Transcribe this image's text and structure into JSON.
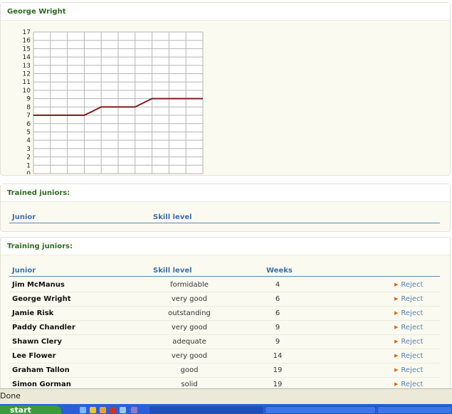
{
  "player_panel": {
    "title": "George Wright"
  },
  "chart_data": {
    "type": "line",
    "title": "",
    "xlabel": "",
    "ylabel": "",
    "x": [
      0,
      1,
      2,
      3,
      4,
      5,
      6,
      7,
      8,
      9,
      10
    ],
    "series": [
      {
        "values": [
          7,
          7,
          7,
          7,
          8,
          8,
          8,
          9,
          9,
          9,
          9
        ]
      }
    ],
    "ylim": [
      0,
      17
    ],
    "y_ticks": [
      "0",
      "1",
      "2",
      "3",
      "4",
      "5",
      "6",
      "7",
      "8",
      "9",
      "10",
      "11",
      "12",
      "13",
      "14",
      "15",
      "16",
      "17"
    ],
    "grid": true,
    "line_color": "#7a1f1f"
  },
  "trained_panel": {
    "title": "Trained juniors:",
    "columns": [
      "Junior",
      "Skill level"
    ]
  },
  "training_panel": {
    "title": "Training juniors:",
    "columns": [
      "Junior",
      "Skill level",
      "Weeks"
    ],
    "rows": [
      {
        "name": "Jim McManus",
        "skill": "formidable",
        "weeks": "4",
        "action": "Reject"
      },
      {
        "name": "George Wright",
        "skill": "very good",
        "weeks": "6",
        "action": "Reject"
      },
      {
        "name": "Jamie Risk",
        "skill": "outstanding",
        "weeks": "6",
        "action": "Reject"
      },
      {
        "name": "Paddy Chandler",
        "skill": "very good",
        "weeks": "9",
        "action": "Reject"
      },
      {
        "name": "Shawn Clery",
        "skill": "adequate",
        "weeks": "9",
        "action": "Reject"
      },
      {
        "name": "Lee Flower",
        "skill": "very good",
        "weeks": "14",
        "action": "Reject"
      },
      {
        "name": "Graham Tallon",
        "skill": "good",
        "weeks": "19",
        "action": "Reject"
      },
      {
        "name": "Simon Gorman",
        "skill": "solid",
        "weeks": "19",
        "action": "Reject"
      }
    ]
  },
  "status_bar": {
    "text": "Done"
  },
  "taskbar": {
    "start_label": "start",
    "accent": "#2a5fd7",
    "start_color": "#3c9a3a"
  }
}
